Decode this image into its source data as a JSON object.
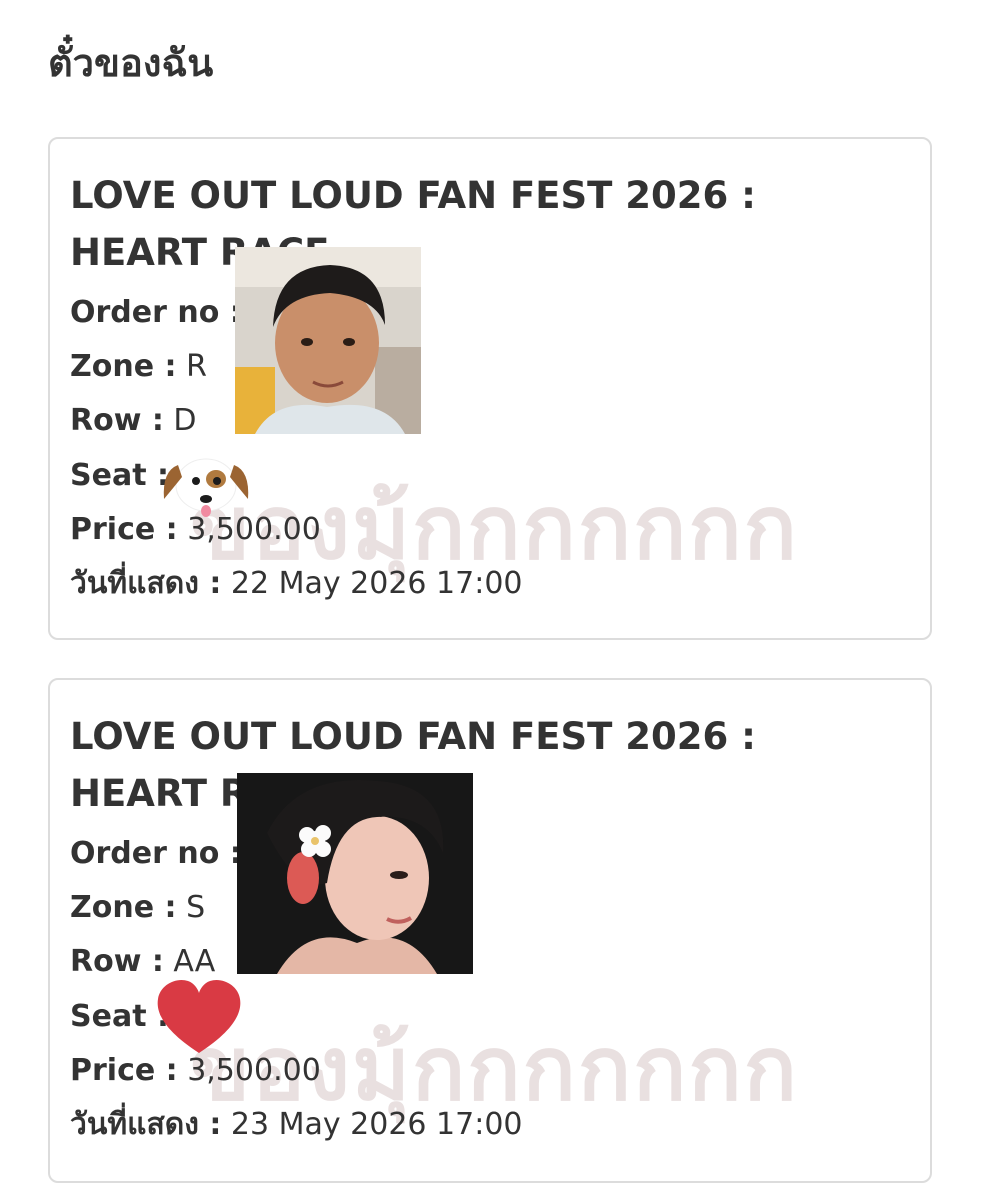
{
  "page": {
    "title": "ตั๋วของฉัน"
  },
  "watermark": "ของมุ้กกกกกกก",
  "tickets": [
    {
      "event": "LOVE OUT LOUD FAN FEST 2026 : HEART RACE",
      "order_label": "Order no :",
      "order_value": "",
      "zone_label": "Zone :",
      "zone_value": "R",
      "row_label": "Row :",
      "row_value": "D",
      "seat_label": "Seat :",
      "seat_value": "",
      "price_label": "Price :",
      "price_value": "3,500.00",
      "date_label": "วันที่แสดง :",
      "date_value": "22 May 2026 17:00",
      "photo": "child-photo",
      "sticker": "dog-face-icon"
    },
    {
      "event": "LOVE OUT LOUD FAN FEST 2026 : HEART RACE",
      "order_label": "Order no :",
      "order_value": "",
      "zone_label": "Zone :",
      "zone_value": "S",
      "row_label": "Row :",
      "row_value": "AA",
      "seat_label": "Seat :",
      "seat_value": "",
      "price_label": "Price :",
      "price_value": "3,500.00",
      "date_label": "วันที่แสดง :",
      "date_value": "23 May 2026 17:00",
      "photo": "portrait-photo",
      "sticker": "heart-icon"
    }
  ],
  "colors": {
    "heart": "#d93a44",
    "watermark": "#e9e0e0",
    "border": "#dcdcdc"
  }
}
